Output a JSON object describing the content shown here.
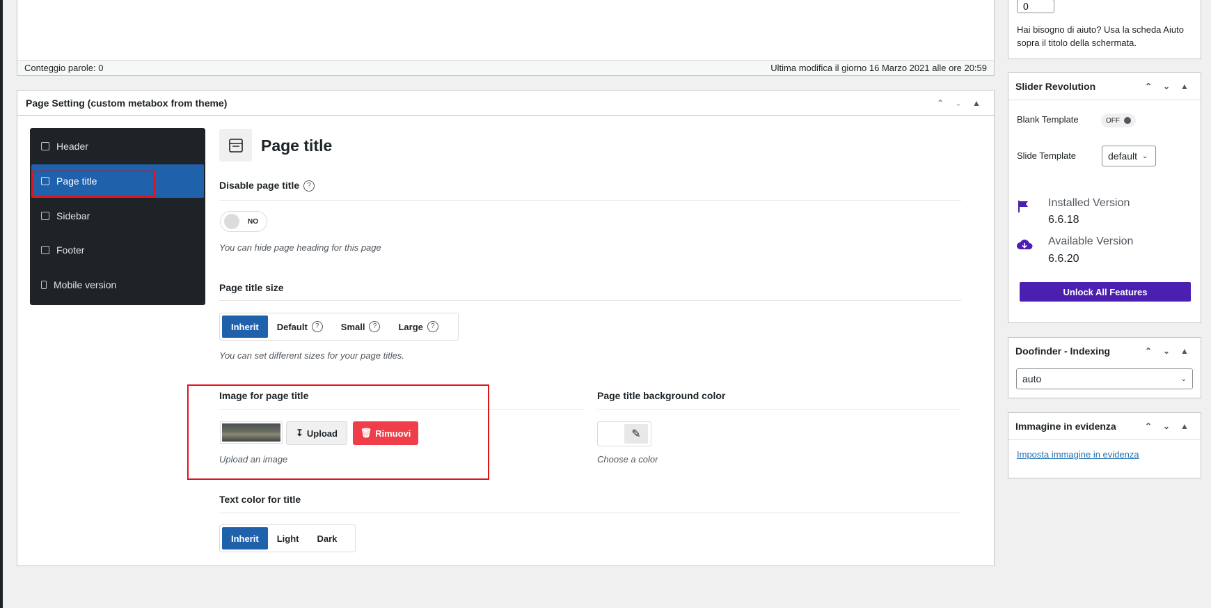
{
  "editor": {
    "word_count": "Conteggio parole: 0",
    "last_modified": "Ultima modifica il giorno 16 Marzo 2021 alle ore 20:59"
  },
  "metabox": {
    "title": "Page Setting (custom metabox from theme)",
    "nav": [
      {
        "label": "Header",
        "icon": "header-icon"
      },
      {
        "label": "Page title",
        "icon": "page-title-icon"
      },
      {
        "label": "Sidebar",
        "icon": "sidebar-icon"
      },
      {
        "label": "Footer",
        "icon": "footer-icon"
      },
      {
        "label": "Mobile version",
        "icon": "mobile-icon"
      }
    ],
    "active_nav": "Page title",
    "panel_title": "Page title",
    "disable_title": {
      "label": "Disable page title",
      "help": "?",
      "toggle_text": "NO",
      "desc": "You can hide page heading for this page"
    },
    "title_size": {
      "label": "Page title size",
      "options": [
        "Inherit",
        "Default",
        "Small",
        "Large"
      ],
      "help": "?",
      "selected": "Inherit",
      "desc": "You can set different sizes for your page titles."
    },
    "image": {
      "label": "Image for page title",
      "upload_label": "Upload",
      "remove_label": "Rimuovi",
      "desc": "Upload an image"
    },
    "bg_color": {
      "label": "Page title background color",
      "desc": "Choose a color"
    },
    "text_color": {
      "label": "Text color for title",
      "options": [
        "Inherit",
        "Light",
        "Dark"
      ],
      "selected": "Inherit"
    }
  },
  "sidebar": {
    "top_widget": {
      "input_value": "0",
      "help_text": "Hai bisogno di aiuto? Usa la scheda Aiuto sopra il titolo della schermata."
    },
    "slider": {
      "title": "Slider Revolution",
      "blank_template_label": "Blank Template",
      "blank_template_toggle": "OFF",
      "slide_template_label": "Slide Template",
      "slide_template_value": "default",
      "installed_label": "Installed Version",
      "installed_value": "6.6.18",
      "available_label": "Available Version",
      "available_value": "6.6.20",
      "unlock_label": "Unlock All Features",
      "accent": "#4b1fb0"
    },
    "doofinder": {
      "title": "Doofinder - Indexing",
      "select_value": "auto"
    },
    "featured": {
      "title": "Immagine in evidenza",
      "link": "Imposta immagine in evidenza"
    }
  },
  "colors": {
    "primary": "#2061ab",
    "danger": "#ef3e4a",
    "nav_bg": "#1d2327",
    "highlight": "#e0141e"
  }
}
